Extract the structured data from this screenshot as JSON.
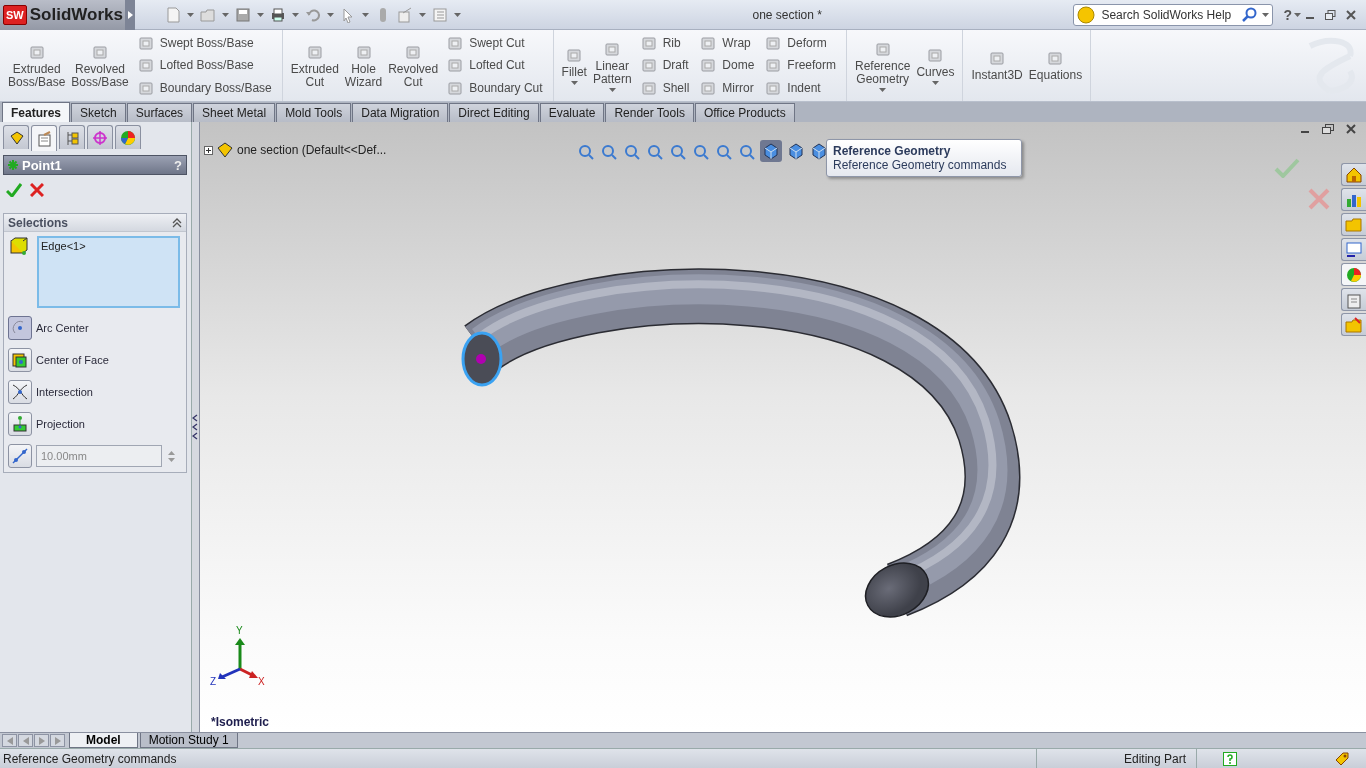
{
  "window": {
    "logo_mark": "SW",
    "logo": "SolidWorks",
    "title": "one section *",
    "help": "?"
  },
  "search": {
    "placeholder": "Search SolidWorks Help"
  },
  "ribbon_groups": [
    {
      "items": [
        {
          "kind": "large",
          "label": "Extruded Boss/Base",
          "dropdown": false
        },
        {
          "kind": "large",
          "label": "Revolved Boss/Base",
          "dropdown": false
        },
        {
          "kind": "small",
          "label": "Swept Boss/Base"
        },
        {
          "kind": "small",
          "label": "Lofted Boss/Base"
        },
        {
          "kind": "small",
          "label": "Boundary Boss/Base"
        }
      ]
    },
    {
      "items": [
        {
          "kind": "large",
          "label": "Extruded Cut",
          "dropdown": false
        },
        {
          "kind": "large",
          "label": "Hole Wizard",
          "dropdown": false
        },
        {
          "kind": "large",
          "label": "Revolved Cut",
          "dropdown": false
        },
        {
          "kind": "small",
          "label": "Swept Cut"
        },
        {
          "kind": "small",
          "label": "Lofted Cut"
        },
        {
          "kind": "small",
          "label": "Boundary Cut"
        }
      ]
    },
    {
      "items": [
        {
          "kind": "large",
          "label": "Fillet",
          "dropdown": true
        },
        {
          "kind": "large",
          "label": "Linear Pattern",
          "dropdown": true
        },
        {
          "kind": "small",
          "label": "Rib"
        },
        {
          "kind": "small",
          "label": "Draft"
        },
        {
          "kind": "small",
          "label": "Shell"
        },
        {
          "kind": "small",
          "label": "Wrap"
        },
        {
          "kind": "small",
          "label": "Dome"
        },
        {
          "kind": "small",
          "label": "Mirror"
        },
        {
          "kind": "small",
          "label": "Deform"
        },
        {
          "kind": "small",
          "label": "Freeform"
        },
        {
          "kind": "small",
          "label": "Indent"
        }
      ]
    },
    {
      "items": [
        {
          "kind": "large",
          "label": "Reference Geometry",
          "dropdown": true
        },
        {
          "kind": "large",
          "label": "Curves",
          "dropdown": true
        }
      ]
    },
    {
      "items": [
        {
          "kind": "large",
          "label": "Instant3D",
          "dropdown": false
        },
        {
          "kind": "large",
          "label": "Equations",
          "dropdown": false
        }
      ]
    }
  ],
  "command_tabs": [
    {
      "label": "Features",
      "selected": true
    },
    {
      "label": "Sketch",
      "selected": false
    },
    {
      "label": "Surfaces",
      "selected": false
    },
    {
      "label": "Sheet Metal",
      "selected": false
    },
    {
      "label": "Mold Tools",
      "selected": false
    },
    {
      "label": "Data Migration",
      "selected": false
    },
    {
      "label": "Direct Editing",
      "selected": false
    },
    {
      "label": "Evaluate",
      "selected": false
    },
    {
      "label": "Render Tools",
      "selected": false
    },
    {
      "label": "Office Products",
      "selected": false
    }
  ],
  "panel_tabs": [
    {
      "selected": false
    },
    {
      "selected": true
    },
    {
      "selected": false
    },
    {
      "selected": false
    },
    {
      "selected": false
    }
  ],
  "property_manager": {
    "title": "Point1",
    "help": "?",
    "selections": {
      "heading": "Selections",
      "expanded": true,
      "entries": [
        "Edge<1>"
      ]
    },
    "options": [
      {
        "label": "Arc Center",
        "selected": true
      },
      {
        "label": "Center of Face",
        "selected": false
      },
      {
        "label": "Intersection",
        "selected": false
      },
      {
        "label": "Projection",
        "selected": false
      }
    ],
    "distance": {
      "value": "10.00mm",
      "disabled": true
    }
  },
  "viewport": {
    "tree_root": "one section  (Default<<Def...",
    "tooltip": {
      "title": "Reference Geometry",
      "text": "Reference Geometry commands"
    },
    "axes": {
      "y": "Y",
      "z": "Z",
      "x": "X"
    },
    "view_name": "*Isometric",
    "task_pane": [
      {
        "selected": false
      },
      {
        "selected": false
      },
      {
        "selected": false
      },
      {
        "selected": false
      },
      {
        "selected": true
      },
      {
        "selected": false
      },
      {
        "selected": false
      }
    ]
  },
  "bottom_tabs": [
    {
      "label": "Model",
      "selected": true
    },
    {
      "label": "Motion Study 1",
      "selected": false
    }
  ],
  "status_bar": {
    "message": "Reference Geometry commands",
    "mode": "Editing Part"
  }
}
